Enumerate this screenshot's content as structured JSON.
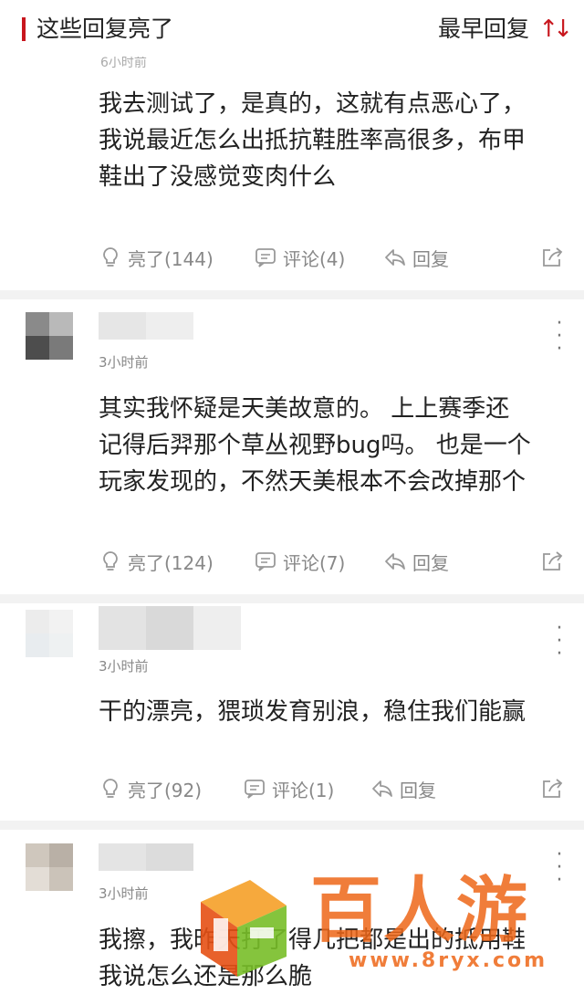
{
  "header": {
    "title": "这些回复亮了",
    "sort_label": "最早回复",
    "sort_icon": "sort-arrows-icon",
    "accent_color": "#c8161d"
  },
  "comments": [
    {
      "time": "6小时前",
      "text_lines": [
        "我去测试了，是真的，这就有点恶心了，",
        "我说最近怎么出抵抗鞋胜率高很多，布甲",
        "鞋出了没感觉变肉什么"
      ],
      "light_label": "亮了(144)",
      "comment_label": "评论(4)",
      "reply_label": "回复"
    },
    {
      "time": "3小时前",
      "text_lines": [
        "其实我怀疑是天美故意的。 上上赛季还",
        "记得后羿那个草丛视野bug吗。 也是一个",
        "玩家发现的，不然天美根本不会改掉那个"
      ],
      "light_label": "亮了(124)",
      "comment_label": "评论(7)",
      "reply_label": "回复"
    },
    {
      "time": "3小时前",
      "text_lines": [
        "干的漂亮，猥琐发育别浪，稳住我们能赢"
      ],
      "light_label": "亮了(92)",
      "comment_label": "评论(1)",
      "reply_label": "回复"
    },
    {
      "time": "3小时前",
      "text_lines": [
        "我擦，我昨天打了得几把都是出的抵用鞋",
        "我说怎么还是那么脆"
      ]
    }
  ],
  "watermark": {
    "brand": "百人游",
    "url": "www.8ryx.com",
    "color": "#ed6618"
  }
}
